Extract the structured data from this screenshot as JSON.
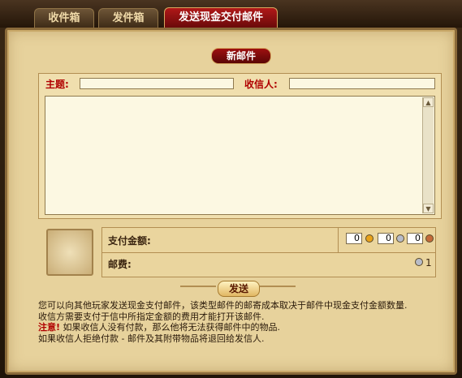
{
  "tabs": [
    {
      "label": "收件箱"
    },
    {
      "label": "发件箱"
    },
    {
      "label": "发送现金交付邮件"
    }
  ],
  "panel": {
    "title": "新邮件"
  },
  "form": {
    "subject_label": "主题:",
    "subject_value": "",
    "recipient_label": "收信人:",
    "recipient_value": "",
    "body_value": ""
  },
  "payment": {
    "amount_label": "支付金额:",
    "gold": "0",
    "silver": "0",
    "copper": "0",
    "postage_label": "邮费:",
    "postage_value": "1"
  },
  "send_button": "发送",
  "info": {
    "line1": "您可以向其他玩家发送现金支付邮件，该类型邮件的邮寄成本取决于邮件中现金支付金额数量.",
    "line2": "收信方需要支付于信中所指定金额的费用才能打开该邮件.",
    "warning_label": "注意!",
    "line3": " 如果收信人没有付款，那么他将无法获得邮件中的物品.",
    "line4": "如果收信人拒绝付款 - 邮件及其附带物品将退回给发信人."
  },
  "colors": {
    "accent_red": "#b00000",
    "parchment": "#e7d29c",
    "tab_active": "#9e1010"
  }
}
